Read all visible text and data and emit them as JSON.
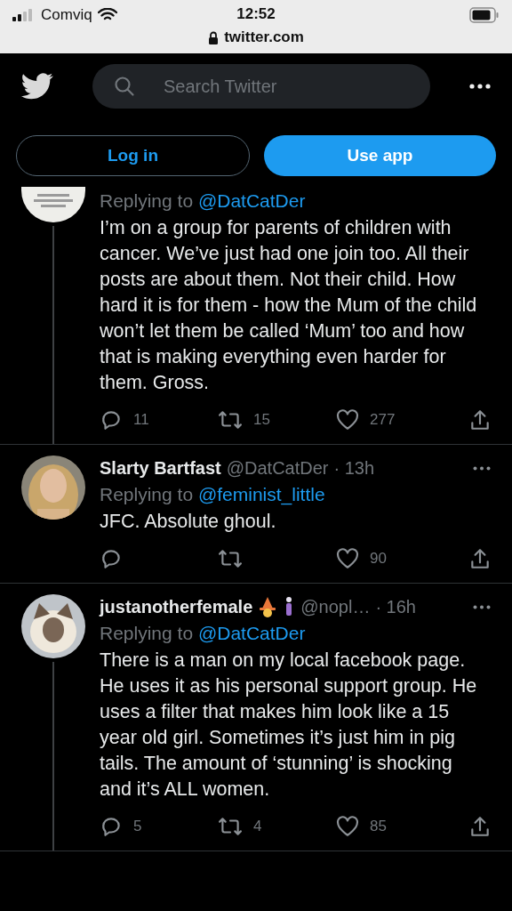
{
  "status_bar": {
    "carrier": "Comviq",
    "time": "12:52",
    "url": "twitter.com"
  },
  "header": {
    "search": {
      "placeholder": "Search Twitter"
    },
    "buttons": [
      {
        "label": "Log in",
        "kind": "outline"
      },
      {
        "label": "Use app",
        "kind": "filled"
      }
    ]
  },
  "tweets": [
    {
      "thread": true,
      "replying_label": "Replying to",
      "replying_to": "@DatCatDer",
      "text": "I’m on a group for parents of children with cancer. We’ve just had one join too. All their posts are about them. Not their child. How hard it is for them - how the Mum of the child won’t let them be called ‘Mum’ too and how that is making everything even harder for them. Gross.",
      "replies": "11",
      "retweets": "15",
      "likes": "277"
    },
    {
      "thread": false,
      "name": "Slarty Bartfast",
      "handle": "@DatCatDer",
      "time": "· 13h",
      "replying_label": "Replying to",
      "replying_to": "@feminist_little",
      "text": "JFC. Absolute ghoul.",
      "likes": "90"
    },
    {
      "thread": true,
      "name": "justanotherfemale",
      "handle": "@nopl…",
      "time": "· 16h",
      "replying_label": "Replying to",
      "replying_to": "@DatCatDer",
      "text": "There is a man on my local facebook page. He uses it as his personal support group. He uses a filter that makes him look like a 15 year old girl. Sometimes it’s just him in pig tails. The amount of ‘stunning’ is shocking and it’s ALL women.",
      "replies": "5",
      "retweets": "4",
      "likes": "85"
    }
  ]
}
